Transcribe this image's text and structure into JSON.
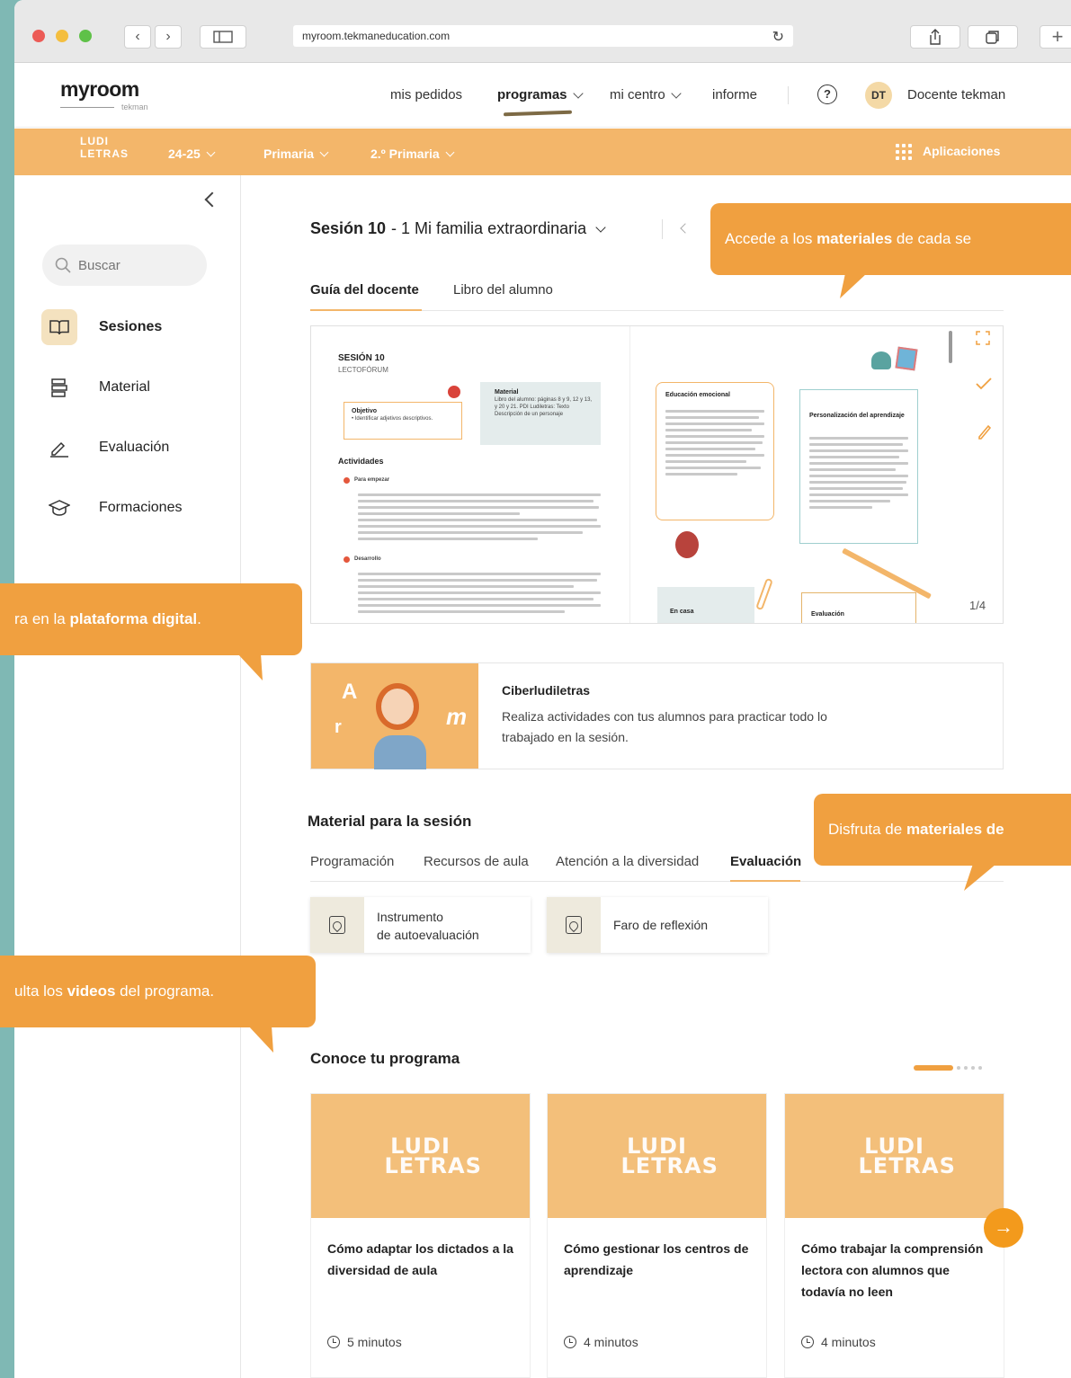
{
  "browser": {
    "url": "myroom.tekmaneducation.com"
  },
  "header": {
    "logo_main": "myroom",
    "logo_sub": "tekman",
    "nav": [
      {
        "label": "mis pedidos"
      },
      {
        "label": "programas"
      },
      {
        "label": "mi centro"
      },
      {
        "label": "informe"
      }
    ],
    "help": "?",
    "avatar_initials": "DT",
    "user_name": "Docente tekman"
  },
  "subbar": {
    "program_logo": "LUDI LETRAS",
    "year": "24-25",
    "stage": "Primaria",
    "grade": "2.º Primaria",
    "apps_label": "Aplicaciones"
  },
  "sidebar": {
    "search_placeholder": "Buscar",
    "items": [
      {
        "label": "Sesiones",
        "icon": "book-icon"
      },
      {
        "label": "Material",
        "icon": "stack-icon"
      },
      {
        "label": "Evaluación",
        "icon": "pencil-check-icon"
      },
      {
        "label": "Formaciones",
        "icon": "graduation-cap-icon"
      }
    ]
  },
  "session": {
    "number": "Sesión 10",
    "name": "- 1 Mi familia extraordinaria"
  },
  "viewer_tabs": [
    "Guía del docente",
    "Libro del alumno"
  ],
  "document": {
    "heading": "SESIÓN 10",
    "subheading": "LECTOFÓRUM",
    "objetivo_label": "Objetivo",
    "objetivo_text": "• Identificar adjetivos descriptivos.",
    "material_label": "Material",
    "material_text": "Libro del alumno: páginas 8 y 9, 12 y 13, y 20 y 21. PDI Ludiletras: Texto Descripción de un personaje",
    "actividades": "Actividades",
    "para_empezar": "Para empezar",
    "desarrollo": "Desarrollo",
    "edu_emocional": "Educación emocional",
    "personalizacion": "Personalización del aprendizaje",
    "en_casa": "En casa",
    "evaluacion": "Evaluación",
    "page_indicator": "1/4"
  },
  "ciberludiletras": {
    "title": "Ciberludiletras",
    "description": "Realiza actividades con tus alumnos para practicar todo lo trabajado en la sesión.",
    "letters": [
      "A",
      "r",
      "m"
    ]
  },
  "material": {
    "title": "Material para la sesión",
    "tabs": [
      "Programación",
      "Recursos de aula",
      "Atención a la diversidad",
      "Evaluación"
    ],
    "resources": [
      {
        "label_line1": "Instrumento",
        "label_line2": "de autoevaluación"
      },
      {
        "label_line1": "Faro de reflexión",
        "label_line2": ""
      }
    ]
  },
  "conoce": {
    "title": "Conoce tu programa",
    "cards": [
      {
        "title": "Cómo adaptar los dictados a la diversidad de aula",
        "duration": "5 minutos"
      },
      {
        "title": "Cómo gestionar los centros de aprendizaje",
        "duration": "4 minutos"
      },
      {
        "title": "Cómo trabajar la comprensión lectora con alumnos que todavía no leen",
        "duration": "4 minutos"
      }
    ]
  },
  "callouts": {
    "c1_pre": "Accede a los ",
    "c1_bold": "materiales",
    "c1_post": " de cada se",
    "c2_pre": "ra en la ",
    "c2_bold": "plataforma digital",
    "c2_post": ".",
    "c3_pre": "Disfruta de ",
    "c3_bold": "materiales de",
    "c4_pre": "ulta los ",
    "c4_bold": "videos",
    "c4_post": " del programa."
  },
  "colors": {
    "accent": "#f3b66a",
    "callout": "#f0a040",
    "background": "#7fb8b4"
  }
}
